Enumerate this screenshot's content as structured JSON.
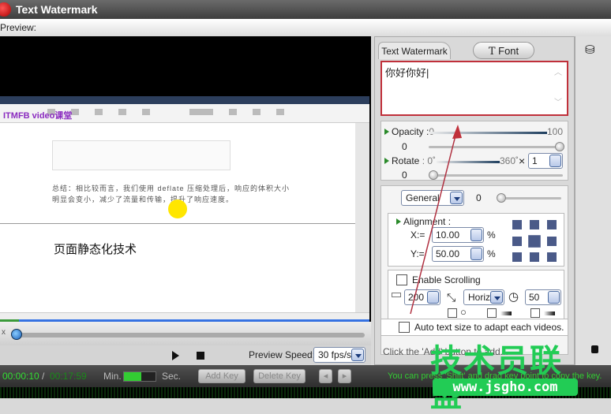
{
  "window": {
    "title": "Text Watermark"
  },
  "preview": {
    "label": "Preview:",
    "doc_text": "页面静态化技术",
    "doc_paragraph": "总结：相比较而言，我们使用 deflate 压缩处理后，响应的体积大小明显会变小，减少了流量和传输，提升了响应速度。",
    "logo": "ITMFB video课堂"
  },
  "timeline": {
    "start_label": "x",
    "knob_value": "0",
    "progress": 0.01
  },
  "playback": {
    "play_icon": "play-icon",
    "stop_icon": "stop-icon",
    "speed_label": "Preview Speed:",
    "speed_value": "30 fps/s"
  },
  "bottombar": {
    "current_time": "00:00:10",
    "separator": "/",
    "total_time": "00:17:59",
    "min_label": "Min.",
    "sec_label": "Sec.",
    "add_key": "Add Key",
    "delete_key": "Delete Key",
    "hint": "You can press 'Shift' and drag key point to copy the key."
  },
  "panel": {
    "tabs": [
      {
        "label": "Text Watermark"
      },
      {
        "label": "Font",
        "icon": "T"
      }
    ],
    "text_value": "你好你好",
    "opacity": {
      "label": "Opacity :",
      "min": "0",
      "max": "100",
      "value": "0"
    },
    "rotate": {
      "label": "Rotate",
      "min": ": 0˚",
      "max": "360˚",
      "times": "×",
      "multiplier": "1",
      "value": "0"
    },
    "effect": {
      "selected": "General",
      "value": "0"
    },
    "alignment": {
      "label": "Alignment :",
      "x_label": "X:=",
      "x_value": "10.00",
      "y_label": "Y:=",
      "y_value": "50.00",
      "unit": "%"
    },
    "scrolling": {
      "label": "Enable Scrolling",
      "width_value": "200",
      "direction": "Horiz",
      "speed_value": "50"
    },
    "auto_size": {
      "label": "Auto text size to adapt each videos."
    },
    "status": "Click the 'Add' button to add..."
  },
  "watermark": {
    "cn": "技术员联盟",
    "url": "www.jsgho.com"
  },
  "colors": {
    "highlight": "#c0303a",
    "green": "#22cc55",
    "time_green": "#33dd33"
  }
}
